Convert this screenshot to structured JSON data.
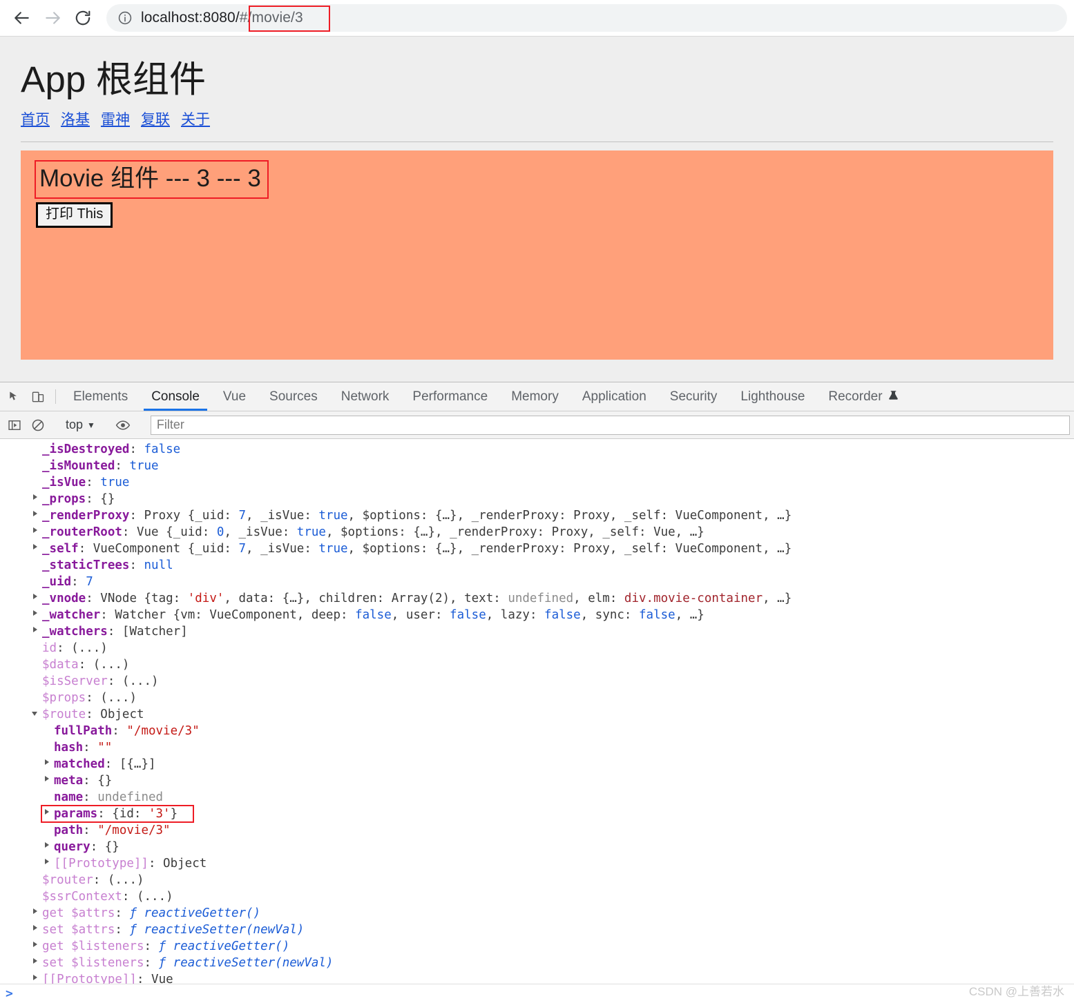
{
  "browser": {
    "back_label": "back-arrow",
    "forward_label": "forward-arrow",
    "reload_label": "reload",
    "site_info_label": "site-information",
    "url_host": "localhost:8080/",
    "url_rest": "#/movie/3",
    "url_full": "localhost:8080/#/movie/3",
    "url_highlight": "#/movie/3",
    "highlight_color": "#ee1c25"
  },
  "page": {
    "title": "App 根组件",
    "nav": [
      {
        "label": "首页"
      },
      {
        "label": "洛基"
      },
      {
        "label": "雷神"
      },
      {
        "label": "复联"
      },
      {
        "label": "关于"
      }
    ],
    "movie": {
      "heading": "Movie 组件 --- 3 --- 3",
      "button_label": "打印 This",
      "container_color": "#ffa07a",
      "page_background": "#eeeeee"
    }
  },
  "devtools": {
    "tabs": [
      {
        "label": "Elements",
        "active": false
      },
      {
        "label": "Console",
        "active": true
      },
      {
        "label": "Vue",
        "active": false
      },
      {
        "label": "Sources",
        "active": false
      },
      {
        "label": "Network",
        "active": false
      },
      {
        "label": "Performance",
        "active": false
      },
      {
        "label": "Memory",
        "active": false
      },
      {
        "label": "Application",
        "active": false
      },
      {
        "label": "Security",
        "active": false
      },
      {
        "label": "Lighthouse",
        "active": false
      },
      {
        "label": "Recorder",
        "active": false,
        "beaker": "⚗"
      }
    ],
    "active_tab": "Console",
    "accent_color": "#1a73e8",
    "toolbar": {
      "inspect_icon": "inspect-element-icon",
      "device_icon": "device-toolbar-icon",
      "sidebar_icon": "console-sidebar-icon",
      "clear_icon": "clear-console-icon",
      "eye_icon": "live-expression-icon",
      "context_label": "top",
      "context_caret": "▼",
      "filter_placeholder": "Filter",
      "filter_value": ""
    },
    "prompt_caret": ">",
    "watermark": "CSDN @上善若水"
  },
  "console_rows": [
    {
      "indent": 0,
      "arrow": "none",
      "segments": [
        {
          "t": "_isDestroyed",
          "c": "k-own"
        },
        {
          "t": ": ",
          "c": "punc"
        },
        {
          "t": "false",
          "c": "v-bool"
        }
      ]
    },
    {
      "indent": 0,
      "arrow": "none",
      "segments": [
        {
          "t": "_isMounted",
          "c": "k-own"
        },
        {
          "t": ": ",
          "c": "punc"
        },
        {
          "t": "true",
          "c": "v-bool"
        }
      ]
    },
    {
      "indent": 0,
      "arrow": "none",
      "segments": [
        {
          "t": "_isVue",
          "c": "k-own"
        },
        {
          "t": ": ",
          "c": "punc"
        },
        {
          "t": "true",
          "c": "v-bool"
        }
      ]
    },
    {
      "indent": 0,
      "arrow": "right",
      "segments": [
        {
          "t": "_props",
          "c": "k-own"
        },
        {
          "t": ": ",
          "c": "punc"
        },
        {
          "t": "{}",
          "c": "v-obj"
        }
      ]
    },
    {
      "indent": 0,
      "arrow": "right",
      "segments": [
        {
          "t": "_renderProxy",
          "c": "k-own"
        },
        {
          "t": ": ",
          "c": "punc"
        },
        {
          "t": "Proxy {_uid: ",
          "c": "v-obj"
        },
        {
          "t": "7",
          "c": "v-num"
        },
        {
          "t": ", _isVue: ",
          "c": "v-obj"
        },
        {
          "t": "true",
          "c": "v-bool"
        },
        {
          "t": ", $options: {…}, _renderProxy: Proxy, _self: VueComponent, …}",
          "c": "v-obj"
        }
      ]
    },
    {
      "indent": 0,
      "arrow": "right",
      "segments": [
        {
          "t": "_routerRoot",
          "c": "k-own"
        },
        {
          "t": ": ",
          "c": "punc"
        },
        {
          "t": "Vue {_uid: ",
          "c": "v-obj"
        },
        {
          "t": "0",
          "c": "v-num"
        },
        {
          "t": ", _isVue: ",
          "c": "v-obj"
        },
        {
          "t": "true",
          "c": "v-bool"
        },
        {
          "t": ", $options: {…}, _renderProxy: Proxy, _self: Vue, …}",
          "c": "v-obj"
        }
      ]
    },
    {
      "indent": 0,
      "arrow": "right",
      "segments": [
        {
          "t": "_self",
          "c": "k-own"
        },
        {
          "t": ": ",
          "c": "punc"
        },
        {
          "t": "VueComponent {_uid: ",
          "c": "v-obj"
        },
        {
          "t": "7",
          "c": "v-num"
        },
        {
          "t": ", _isVue: ",
          "c": "v-obj"
        },
        {
          "t": "true",
          "c": "v-bool"
        },
        {
          "t": ", $options: {…}, _renderProxy: Proxy, _self: VueComponent, …}",
          "c": "v-obj"
        }
      ]
    },
    {
      "indent": 0,
      "arrow": "none",
      "segments": [
        {
          "t": "_staticTrees",
          "c": "k-own"
        },
        {
          "t": ": ",
          "c": "punc"
        },
        {
          "t": "null",
          "c": "v-null"
        }
      ]
    },
    {
      "indent": 0,
      "arrow": "none",
      "segments": [
        {
          "t": "_uid",
          "c": "k-own"
        },
        {
          "t": ": ",
          "c": "punc"
        },
        {
          "t": "7",
          "c": "v-num"
        }
      ]
    },
    {
      "indent": 0,
      "arrow": "right",
      "segments": [
        {
          "t": "_vnode",
          "c": "k-own"
        },
        {
          "t": ": ",
          "c": "punc"
        },
        {
          "t": "VNode {tag: ",
          "c": "v-obj"
        },
        {
          "t": "'div'",
          "c": "v-str"
        },
        {
          "t": ", data: {…}, children: Array(2), text: ",
          "c": "v-obj"
        },
        {
          "t": "undefined",
          "c": "v-undef"
        },
        {
          "t": ", elm: ",
          "c": "v-obj"
        },
        {
          "t": "div.movie-container",
          "c": "v-node"
        },
        {
          "t": ", …}",
          "c": "v-obj"
        }
      ]
    },
    {
      "indent": 0,
      "arrow": "right",
      "segments": [
        {
          "t": "_watcher",
          "c": "k-own"
        },
        {
          "t": ": ",
          "c": "punc"
        },
        {
          "t": "Watcher {vm: VueComponent, deep: ",
          "c": "v-obj"
        },
        {
          "t": "false",
          "c": "v-bool"
        },
        {
          "t": ", user: ",
          "c": "v-obj"
        },
        {
          "t": "false",
          "c": "v-bool"
        },
        {
          "t": ", lazy: ",
          "c": "v-obj"
        },
        {
          "t": "false",
          "c": "v-bool"
        },
        {
          "t": ", sync: ",
          "c": "v-obj"
        },
        {
          "t": "false",
          "c": "v-bool"
        },
        {
          "t": ", …}",
          "c": "v-obj"
        }
      ]
    },
    {
      "indent": 0,
      "arrow": "right",
      "segments": [
        {
          "t": "_watchers",
          "c": "k-own"
        },
        {
          "t": ": ",
          "c": "punc"
        },
        {
          "t": "[Watcher]",
          "c": "v-obj"
        }
      ]
    },
    {
      "indent": 0,
      "arrow": "none",
      "segments": [
        {
          "t": "id",
          "c": "k-get"
        },
        {
          "t": ": ",
          "c": "punc"
        },
        {
          "t": "(...)",
          "c": "v-obj"
        }
      ]
    },
    {
      "indent": 0,
      "arrow": "none",
      "segments": [
        {
          "t": "$data",
          "c": "k-get"
        },
        {
          "t": ": ",
          "c": "punc"
        },
        {
          "t": "(...)",
          "c": "v-obj"
        }
      ]
    },
    {
      "indent": 0,
      "arrow": "none",
      "segments": [
        {
          "t": "$isServer",
          "c": "k-get"
        },
        {
          "t": ": ",
          "c": "punc"
        },
        {
          "t": "(...)",
          "c": "v-obj"
        }
      ]
    },
    {
      "indent": 0,
      "arrow": "none",
      "segments": [
        {
          "t": "$props",
          "c": "k-get"
        },
        {
          "t": ": ",
          "c": "punc"
        },
        {
          "t": "(...)",
          "c": "v-obj"
        }
      ]
    },
    {
      "indent": 0,
      "arrow": "down",
      "segments": [
        {
          "t": "$route",
          "c": "k-get"
        },
        {
          "t": ": ",
          "c": "punc"
        },
        {
          "t": "Object",
          "c": "v-obj"
        }
      ]
    },
    {
      "indent": 1,
      "arrow": "none",
      "segments": [
        {
          "t": "fullPath",
          "c": "k-own"
        },
        {
          "t": ": ",
          "c": "punc"
        },
        {
          "t": "\"/movie/3\"",
          "c": "v-str"
        }
      ]
    },
    {
      "indent": 1,
      "arrow": "none",
      "segments": [
        {
          "t": "hash",
          "c": "k-own"
        },
        {
          "t": ": ",
          "c": "punc"
        },
        {
          "t": "\"\"",
          "c": "v-str"
        }
      ]
    },
    {
      "indent": 1,
      "arrow": "right",
      "segments": [
        {
          "t": "matched",
          "c": "k-own"
        },
        {
          "t": ": ",
          "c": "punc"
        },
        {
          "t": "[{…}]",
          "c": "v-obj"
        }
      ]
    },
    {
      "indent": 1,
      "arrow": "right",
      "segments": [
        {
          "t": "meta",
          "c": "k-own"
        },
        {
          "t": ": ",
          "c": "punc"
        },
        {
          "t": "{}",
          "c": "v-obj"
        }
      ]
    },
    {
      "indent": 1,
      "arrow": "none",
      "segments": [
        {
          "t": "name",
          "c": "k-own"
        },
        {
          "t": ": ",
          "c": "punc"
        },
        {
          "t": "undefined",
          "c": "v-undef"
        }
      ]
    },
    {
      "indent": 1,
      "arrow": "right",
      "segments": [
        {
          "t": "params",
          "c": "k-own"
        },
        {
          "t": ": ",
          "c": "punc"
        },
        {
          "t": "{id: ",
          "c": "v-obj"
        },
        {
          "t": "'3'",
          "c": "v-str"
        },
        {
          "t": "}",
          "c": "v-obj"
        }
      ]
    },
    {
      "indent": 1,
      "arrow": "none",
      "segments": [
        {
          "t": "path",
          "c": "k-own"
        },
        {
          "t": ": ",
          "c": "punc"
        },
        {
          "t": "\"/movie/3\"",
          "c": "v-str"
        }
      ]
    },
    {
      "indent": 1,
      "arrow": "right",
      "segments": [
        {
          "t": "query",
          "c": "k-own"
        },
        {
          "t": ": ",
          "c": "punc"
        },
        {
          "t": "{}",
          "c": "v-obj"
        }
      ]
    },
    {
      "indent": 1,
      "arrow": "right",
      "segments": [
        {
          "t": "[[Prototype]]",
          "c": "k-proto"
        },
        {
          "t": ": ",
          "c": "punc"
        },
        {
          "t": "Object",
          "c": "v-obj"
        }
      ]
    },
    {
      "indent": 0,
      "arrow": "none",
      "segments": [
        {
          "t": "$router",
          "c": "k-get"
        },
        {
          "t": ": ",
          "c": "punc"
        },
        {
          "t": "(...)",
          "c": "v-obj"
        }
      ]
    },
    {
      "indent": 0,
      "arrow": "none",
      "segments": [
        {
          "t": "$ssrContext",
          "c": "k-get"
        },
        {
          "t": ": ",
          "c": "punc"
        },
        {
          "t": "(...)",
          "c": "v-obj"
        }
      ]
    },
    {
      "indent": 0,
      "arrow": "right",
      "segments": [
        {
          "t": "get $attrs",
          "c": "k-get"
        },
        {
          "t": ": ",
          "c": "punc"
        },
        {
          "t": "ƒ ",
          "c": "v-fnmark"
        },
        {
          "t": "reactiveGetter()",
          "c": "v-fn"
        }
      ]
    },
    {
      "indent": 0,
      "arrow": "right",
      "segments": [
        {
          "t": "set $attrs",
          "c": "k-get"
        },
        {
          "t": ": ",
          "c": "punc"
        },
        {
          "t": "ƒ ",
          "c": "v-fnmark"
        },
        {
          "t": "reactiveSetter(newVal)",
          "c": "v-fn"
        }
      ]
    },
    {
      "indent": 0,
      "arrow": "right",
      "segments": [
        {
          "t": "get $listeners",
          "c": "k-get"
        },
        {
          "t": ": ",
          "c": "punc"
        },
        {
          "t": "ƒ ",
          "c": "v-fnmark"
        },
        {
          "t": "reactiveGetter()",
          "c": "v-fn"
        }
      ]
    },
    {
      "indent": 0,
      "arrow": "right",
      "segments": [
        {
          "t": "set $listeners",
          "c": "k-get"
        },
        {
          "t": ": ",
          "c": "punc"
        },
        {
          "t": "ƒ ",
          "c": "v-fnmark"
        },
        {
          "t": "reactiveSetter(newVal)",
          "c": "v-fn"
        }
      ]
    },
    {
      "indent": 0,
      "arrow": "right",
      "segments": [
        {
          "t": "[[Prototype]]",
          "c": "k-proto"
        },
        {
          "t": ": ",
          "c": "punc"
        },
        {
          "t": "Vue",
          "c": "v-obj"
        }
      ]
    }
  ]
}
